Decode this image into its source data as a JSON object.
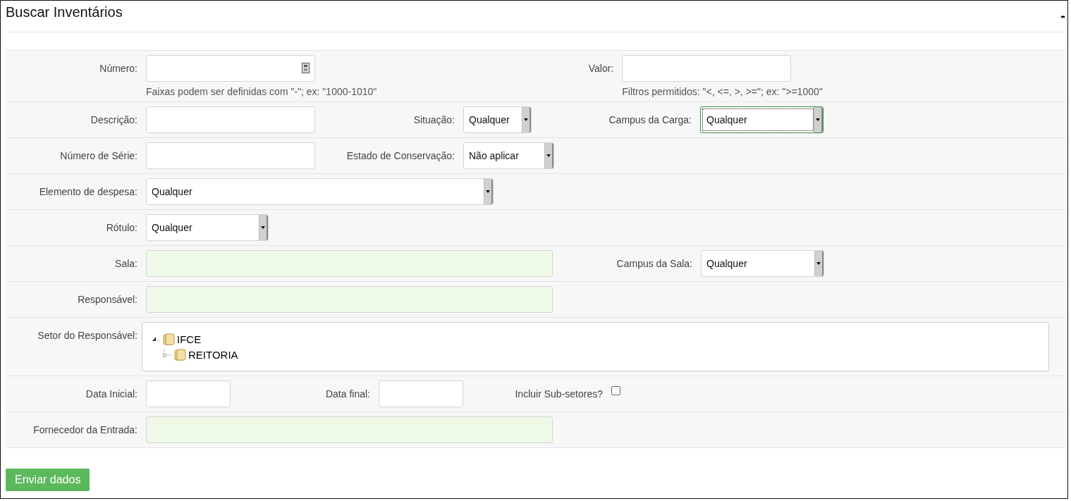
{
  "panel": {
    "title": "Buscar Inventários",
    "collapse": "-"
  },
  "rows": [
    {
      "fields": [
        {
          "kind": "number",
          "label": "Número:",
          "hint": "Faixas podem ser definidas com \"-\"; ex: \"1000-1010\""
        },
        {
          "kind": "text",
          "label": "Valor:",
          "hint": "Filtros permitidos: \"<, <=, >, >=\"; ex: \">=1000\""
        }
      ]
    },
    {
      "fields": [
        {
          "kind": "text",
          "label": "Descrição:"
        },
        {
          "kind": "select",
          "label": "Situação:",
          "value": "Qualquer",
          "focused": false
        },
        {
          "kind": "select",
          "label": "Campus da Carga:",
          "value": "Qualquer",
          "focused": true
        }
      ]
    },
    {
      "fields": [
        {
          "kind": "text",
          "label": "Número de Série:"
        },
        {
          "kind": "select",
          "label": "Estado de Conservação:",
          "value": "Não aplicar",
          "focused": false
        }
      ]
    },
    {
      "fields": [
        {
          "kind": "select",
          "label": "Elemento de despesa:",
          "value": "Qualquer",
          "focused": false
        }
      ]
    },
    {
      "fields": [
        {
          "kind": "select",
          "label": "Rótulo:",
          "value": "Qualquer",
          "focused": false
        }
      ]
    },
    {
      "fields": [
        {
          "kind": "lookup",
          "label": "Sala:"
        },
        {
          "kind": "select",
          "label": "Campus da Sala:",
          "value": "Qualquer",
          "focused": false
        }
      ]
    },
    {
      "fields": [
        {
          "kind": "lookup",
          "label": "Responsável:"
        }
      ]
    },
    {
      "fields": [
        {
          "kind": "tree",
          "label": "Setor do Responsável:",
          "nodes": [
            {
              "label": "IFCE",
              "expanded": true,
              "children": [
                {
                  "label": "REITORIA",
                  "expanded": false
                }
              ]
            }
          ]
        }
      ]
    },
    {
      "fields": [
        {
          "kind": "date",
          "label": "Data Inicial:"
        },
        {
          "kind": "date",
          "label": "Data final:"
        },
        {
          "kind": "checkbox",
          "label": "Incluir Sub-setores?",
          "checked": false
        }
      ]
    },
    {
      "fields": [
        {
          "kind": "lookup",
          "label": "Fornecedor da Entrada:"
        }
      ]
    }
  ],
  "submit": "Enviar dados"
}
